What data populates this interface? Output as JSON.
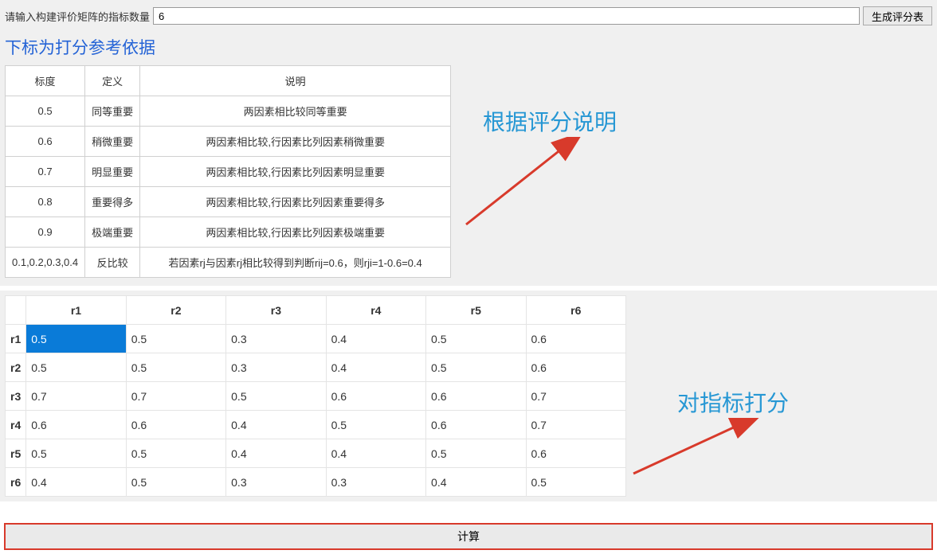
{
  "top": {
    "label": "请输入构建评价矩阵的指标数量",
    "value": "6",
    "generate_label": "生成评分表"
  },
  "subtitle": "下标为打分参考依据",
  "ref_table": {
    "headers": [
      "标度",
      "定义",
      "说明"
    ],
    "rows": [
      {
        "scale": "0.5",
        "def": "同等重要",
        "desc": "两因素相比较同等重要"
      },
      {
        "scale": "0.6",
        "def": "稍微重要",
        "desc": "两因素相比较,行因素比列因素稍微重要"
      },
      {
        "scale": "0.7",
        "def": "明显重要",
        "desc": "两因素相比较,行因素比列因素明显重要"
      },
      {
        "scale": "0.8",
        "def": "重要得多",
        "desc": "两因素相比较,行因素比列因素重要得多"
      },
      {
        "scale": "0.9",
        "def": "极端重要",
        "desc": "两因素相比较,行因素比列因素极端重要"
      },
      {
        "scale": "0.1,0.2,0.3,0.4",
        "def": "反比较",
        "desc": "若因素rj与因素rj相比较得到判断rij=0.6，则rji=1-0.6=0.4"
      }
    ]
  },
  "annotations": {
    "desc_note": "根据评分说明",
    "score_note": "对指标打分"
  },
  "grid": {
    "col_headers": [
      "r1",
      "r2",
      "r3",
      "r4",
      "r5",
      "r6"
    ],
    "row_headers": [
      "r1",
      "r2",
      "r3",
      "r4",
      "r5",
      "r6"
    ],
    "cells": [
      [
        "0.5",
        "0.5",
        "0.3",
        "0.4",
        "0.5",
        "0.6"
      ],
      [
        "0.5",
        "0.5",
        "0.3",
        "0.4",
        "0.5",
        "0.6"
      ],
      [
        "0.7",
        "0.7",
        "0.5",
        "0.6",
        "0.6",
        "0.7"
      ],
      [
        "0.6",
        "0.6",
        "0.4",
        "0.5",
        "0.6",
        "0.7"
      ],
      [
        "0.5",
        "0.5",
        "0.4",
        "0.4",
        "0.5",
        "0.6"
      ],
      [
        "0.4",
        "0.5",
        "0.3",
        "0.3",
        "0.4",
        "0.5"
      ]
    ],
    "selected": {
      "row": 0,
      "col": 0
    }
  },
  "bottom": {
    "compute_label": "计算"
  },
  "chart_data": {
    "type": "table",
    "title": "评价矩阵",
    "row_labels": [
      "r1",
      "r2",
      "r3",
      "r4",
      "r5",
      "r6"
    ],
    "col_labels": [
      "r1",
      "r2",
      "r3",
      "r4",
      "r5",
      "r6"
    ],
    "values": [
      [
        0.5,
        0.5,
        0.3,
        0.4,
        0.5,
        0.6
      ],
      [
        0.5,
        0.5,
        0.3,
        0.4,
        0.5,
        0.6
      ],
      [
        0.7,
        0.7,
        0.5,
        0.6,
        0.6,
        0.7
      ],
      [
        0.6,
        0.6,
        0.4,
        0.5,
        0.6,
        0.7
      ],
      [
        0.5,
        0.5,
        0.4,
        0.4,
        0.5,
        0.6
      ],
      [
        0.4,
        0.5,
        0.3,
        0.3,
        0.4,
        0.5
      ]
    ]
  }
}
